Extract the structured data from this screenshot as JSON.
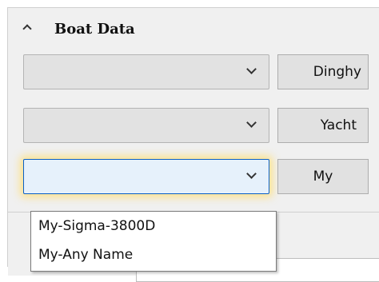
{
  "section": {
    "title": "Boat Data",
    "toggle_icon": "chevron-up-icon"
  },
  "rows": [
    {
      "combo_value": "",
      "button_label": "Dinghy"
    },
    {
      "combo_value": "",
      "button_label": "Yacht"
    },
    {
      "combo_value": "",
      "button_label": "My"
    }
  ],
  "dropdown": {
    "options": [
      "My-Sigma-3800D",
      "My-Any Name"
    ]
  },
  "colors": {
    "panel_bg": "#f0f0f0",
    "focus_border": "#0a5fc6",
    "focus_glow": "#ffdd6e"
  }
}
